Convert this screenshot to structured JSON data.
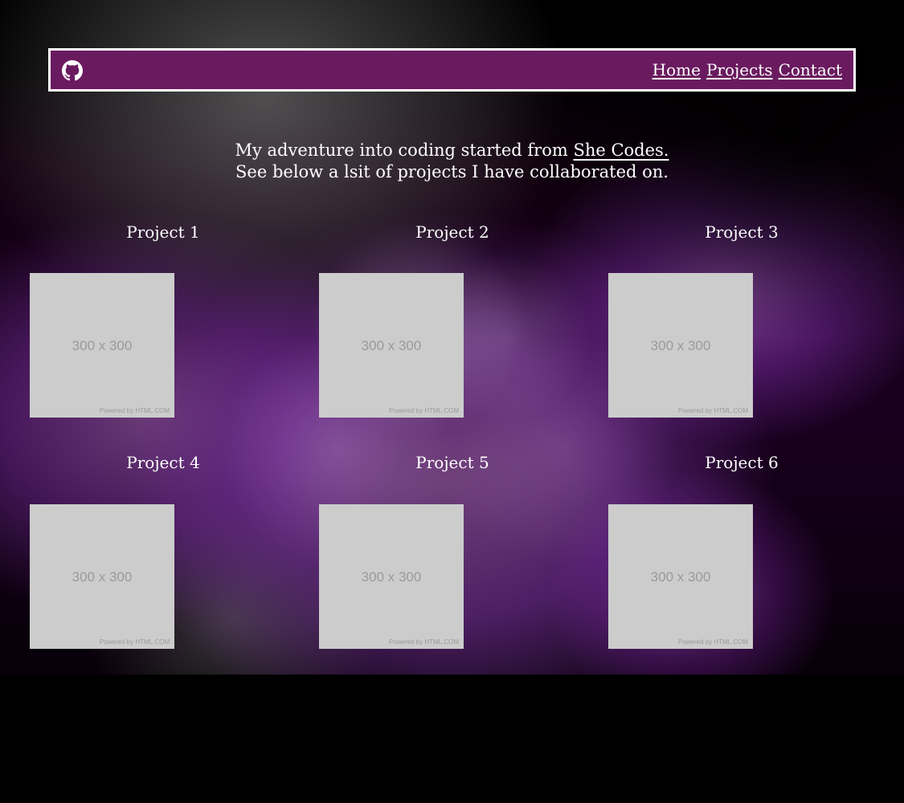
{
  "colors": {
    "page_background": "#000000",
    "navbar_background": "#6a1b5f",
    "navbar_border": "#ffffff",
    "text": "#ffffff",
    "thumb_background": "#cccccc",
    "thumb_text": "#9a9a9a",
    "backdrop_accent": "#7a2aa6"
  },
  "navbar": {
    "icon": "github-icon",
    "links": [
      "Home",
      "Projects",
      "Contact"
    ]
  },
  "intro": {
    "line1_before_link": "My adventure into coding started from ",
    "link_text": "She Codes.",
    "line2": "See below a lsit of projects I have collaborated on."
  },
  "projects": [
    {
      "title": "Project 1",
      "thumb_label": "300 x 300",
      "thumb_powered": "Powered by HTML.COM"
    },
    {
      "title": "Project 2",
      "thumb_label": "300 x 300",
      "thumb_powered": "Powered by HTML.COM"
    },
    {
      "title": "Project 3",
      "thumb_label": "300 x 300",
      "thumb_powered": "Powered by HTML.COM"
    },
    {
      "title": "Project 4",
      "thumb_label": "300 x 300",
      "thumb_powered": "Powered by HTML.COM"
    },
    {
      "title": "Project 5",
      "thumb_label": "300 x 300",
      "thumb_powered": "Powered by HTML.COM"
    },
    {
      "title": "Project 6",
      "thumb_label": "300 x 300",
      "thumb_powered": "Powered by HTML.COM"
    }
  ]
}
